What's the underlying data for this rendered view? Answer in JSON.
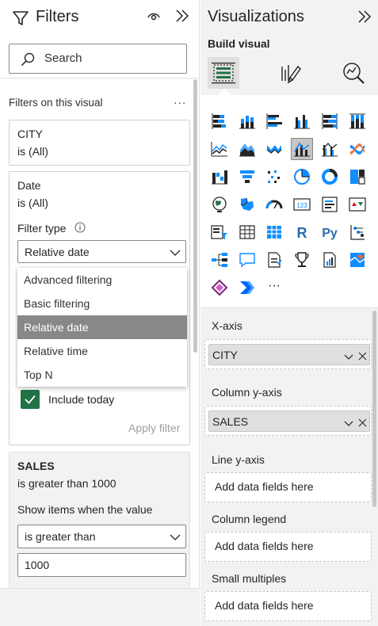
{
  "filters": {
    "title": "Filters",
    "search_placeholder": "Search",
    "section_label": "Filters on this visual",
    "more_label": "...",
    "cards": {
      "city": {
        "field": "CITY",
        "summary": "is (All)"
      },
      "date": {
        "field": "Date",
        "summary": "is (All)",
        "filter_type_label": "Filter type",
        "filter_type_value": "Relative date",
        "options": [
          "Advanced filtering",
          "Basic filtering",
          "Relative date",
          "Relative time",
          "Top N"
        ],
        "selected_option": "Relative date",
        "include_today_label": "Include today",
        "include_today_checked": true,
        "apply_label": "Apply filter"
      },
      "sales": {
        "field": "SALES",
        "summary": "is greater than 1000",
        "condition_label": "Show items when the value",
        "condition_value": "is greater than",
        "threshold_value": "1000"
      }
    }
  },
  "viz": {
    "title": "Visualizations",
    "build_label": "Build visual",
    "tabs": [
      "build-visual-icon",
      "format-visual-icon",
      "analytics-icon"
    ],
    "gallery": {
      "icons": [
        "stacked-bar-chart",
        "stacked-column-chart",
        "clustered-bar-chart",
        "clustered-column-chart",
        "100-stacked-bar-chart",
        "100-stacked-column-chart",
        "line-chart",
        "area-chart",
        "stacked-area-chart",
        "line-and-stacked-column-chart",
        "line-and-clustered-column-chart",
        "ribbon-chart",
        "waterfall-chart",
        "funnel-chart",
        "scatter-chart",
        "pie-chart",
        "donut-chart",
        "treemap",
        "map",
        "filled-map",
        "gauge",
        "card",
        "multi-row-card",
        "kpi",
        "slicer",
        "table",
        "matrix",
        "r-script-visual",
        "python-visual",
        "key-influencers",
        "decomposition-tree",
        "qa-visual",
        "smart-narrative",
        "goals",
        "paginated-report",
        "azure-map",
        "power-apps",
        "power-automate",
        "more-visuals"
      ],
      "active_icon": "line-and-stacked-column-chart",
      "more_label": "···"
    },
    "wells": {
      "x_axis": {
        "label": "X-axis",
        "field": "CITY"
      },
      "column_y": {
        "label": "Column y-axis",
        "field": "SALES"
      },
      "line_y": {
        "label": "Line y-axis",
        "placeholder": "Add data fields here"
      },
      "column_legend": {
        "label": "Column legend",
        "placeholder": "Add data fields here"
      },
      "small_multiples": {
        "label": "Small multiples",
        "placeholder": "Add data fields here"
      }
    }
  },
  "colors": {
    "accent_green": "#217346",
    "selected_gray": "#8a8886",
    "pane_bg": "#f3f2f1",
    "icon_blue": "#2b6cb0",
    "icon_teal": "#118dff"
  }
}
